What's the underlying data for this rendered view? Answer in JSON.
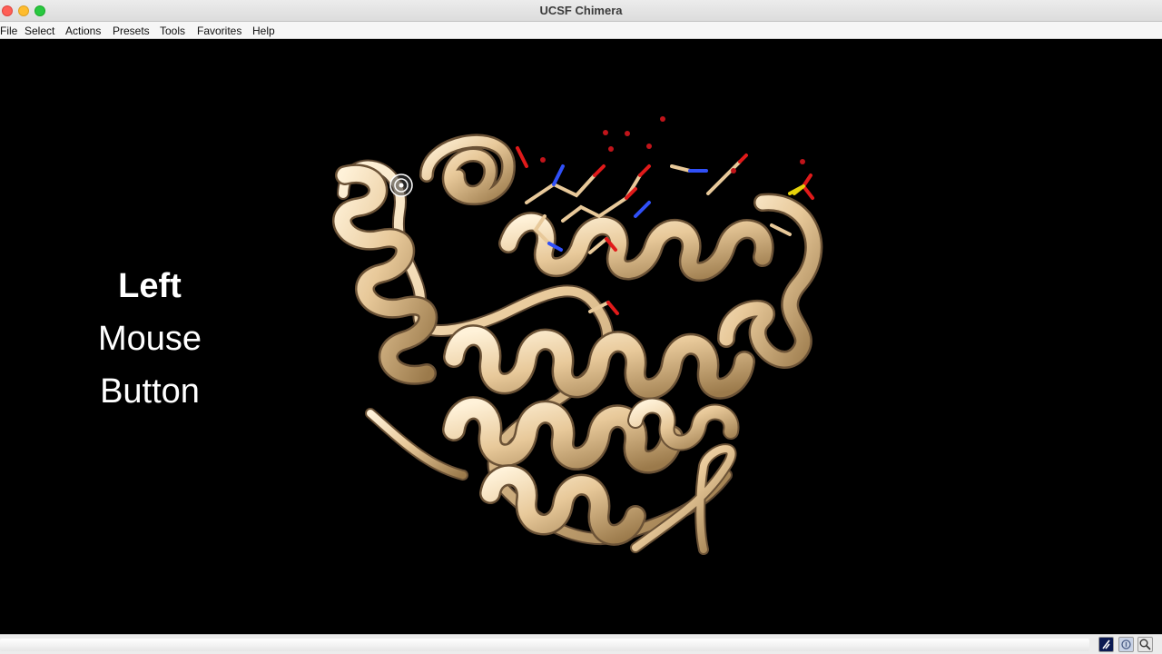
{
  "window": {
    "title": "UCSF Chimera"
  },
  "menu": [
    "File",
    "Select",
    "Actions",
    "Presets",
    "Tools",
    "Favorites",
    "Help"
  ],
  "overlay": {
    "line1": "Left",
    "line2": "Mouse",
    "line3": "Button"
  },
  "status": {
    "message": ""
  },
  "colors": {
    "ribbon": "#e8c99a",
    "background": "#000000",
    "oxygen": "#e01a1a",
    "nitrogen": "#3050f8",
    "sulfur": "#e6d20a"
  },
  "icons": [
    "ribbon-tool-icon",
    "structure-info-icon",
    "zoom-icon"
  ]
}
